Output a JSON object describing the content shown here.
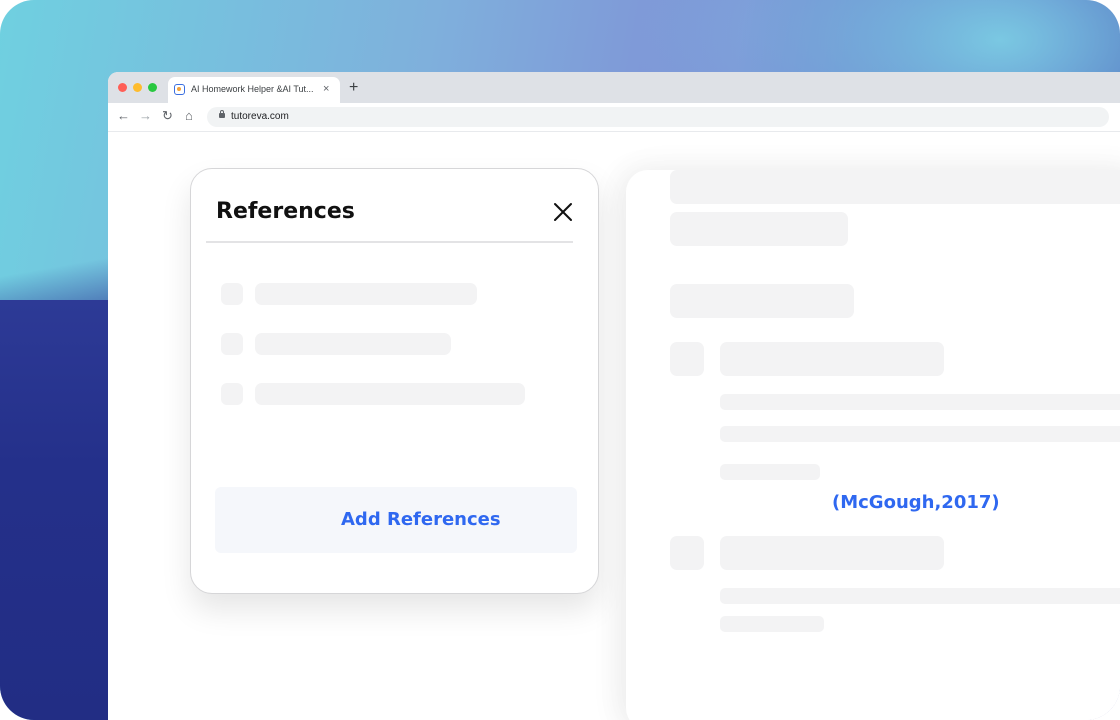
{
  "browser": {
    "tab_title": "AI Homework Helper &AI Tut...",
    "tab_close": "×",
    "new_tab": "+",
    "url": "tutoreva.com",
    "nav": {
      "back": "←",
      "forward": "→",
      "reload": "↻",
      "home": "⌂",
      "star": "☆"
    }
  },
  "references_panel": {
    "title": "References",
    "add_button_label": "Add References",
    "placeholder_item_count": 3
  },
  "document": {
    "citation": "(McGough,2017)"
  },
  "colors": {
    "accent": "#2f68f0",
    "placeholder": "#f3f3f4",
    "title_text": "#111111"
  }
}
